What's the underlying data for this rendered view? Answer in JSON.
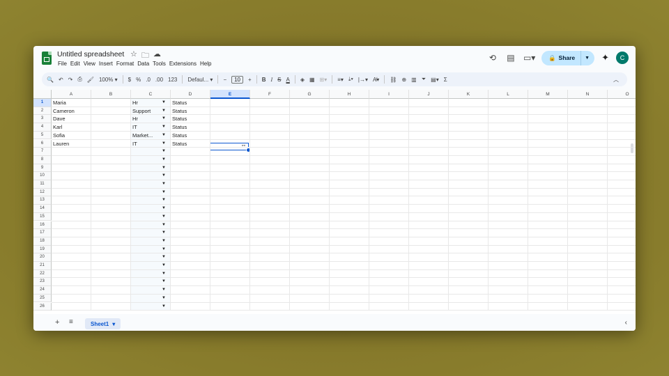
{
  "doc": {
    "title": "Untitled spreadsheet"
  },
  "menu": [
    "File",
    "Edit",
    "View",
    "Insert",
    "Format",
    "Data",
    "Tools",
    "Extensions",
    "Help"
  ],
  "actions": {
    "share_label": "Share",
    "avatar_letter": "C"
  },
  "toolbar": {
    "zoom": "100%",
    "currency": "$",
    "percent": "%",
    "dec_decrease": ".0",
    "dec_increase": ".00",
    "number_format": "123",
    "font": "Defaul...",
    "font_size": "10",
    "bold": "B",
    "italic": "I",
    "strike": "S",
    "text_color": "A",
    "function": "Σ"
  },
  "columns": [
    "A",
    "B",
    "C",
    "D",
    "E",
    "F",
    "G",
    "H",
    "I",
    "J",
    "K",
    "L",
    "M",
    "N",
    "O"
  ],
  "selected_column": "E",
  "selected_row": 1,
  "rows": [
    {
      "a": "Maria",
      "c": "Hr",
      "d": "Status"
    },
    {
      "a": "Cameron",
      "c": "Support",
      "d": "Status"
    },
    {
      "a": "Dave",
      "c": "Hr",
      "d": "Status"
    },
    {
      "a": "Karl",
      "c": "IT",
      "d": "Status"
    },
    {
      "a": "Sofia",
      "c": "Market...",
      "d": "Status"
    },
    {
      "a": "Lauren",
      "c": "IT",
      "d": "Status"
    }
  ],
  "row_count": 26,
  "sheets": [
    {
      "name": "Sheet1",
      "active": true
    }
  ],
  "colors": {
    "accent": "#0b57d0",
    "share_bg": "#c2e7ff",
    "logo": "#188038",
    "avatar": "#00796b"
  }
}
